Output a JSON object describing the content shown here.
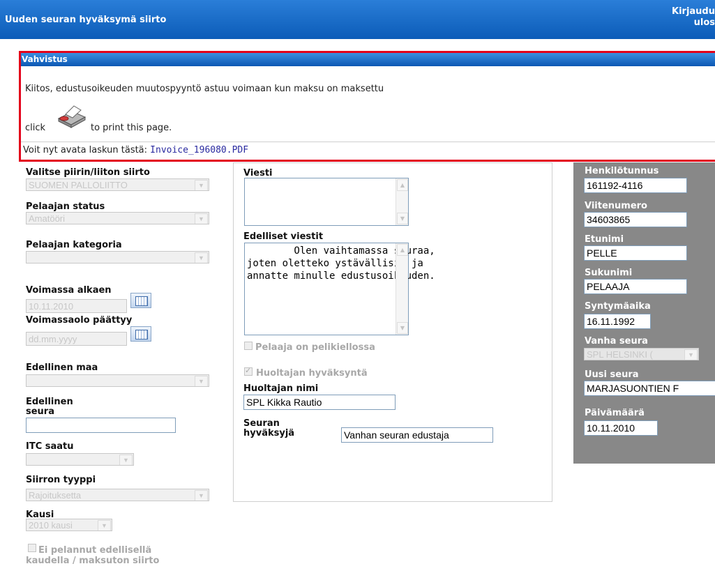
{
  "header": {
    "title": "Uuden seuran hyväksymä siirto",
    "logout_line1": "Kirjaudu",
    "logout_line2": "ulos"
  },
  "dialog": {
    "title": "Vahvistus",
    "message": "Kiitos, edustusoikeuden muutospyyntö astuu voimaan kun maksu on maksettu",
    "click_label": "click",
    "print_label": "to print this page.",
    "invoice_prefix": "Voit nyt avata laskun tästä: ",
    "invoice_link": "Invoice_196080.PDF"
  },
  "left": {
    "district_label": "Valitse piirin/liiton siirto",
    "district_value": "SUOMEN PALLOLIITTO",
    "status_label": "Pelaajan status",
    "status_value": "Amatööri",
    "category_label": "Pelaajan kategoria",
    "category_value": "",
    "valid_from_label": "Voimassa alkaen",
    "valid_from_value": "10.11.2010",
    "valid_to_label": "Voimassaolo päättyy",
    "valid_to_placeholder": "dd.mm.yyyy",
    "prev_country_label": "Edellinen maa",
    "prev_country_value": "",
    "prev_club_label_1": "Edellinen",
    "prev_club_label_2": "seura",
    "prev_club_value": "",
    "itc_label": "ITC saatu",
    "itc_value": "",
    "transfer_type_label": "Siirron tyyppi",
    "transfer_type_value": "Rajoituksetta",
    "season_label": "Kausi",
    "season_value": "2010 kausi",
    "no_play_label_1": "Ei pelannut edellisellä",
    "no_play_label_2": "kaudella / maksuton siirto"
  },
  "middle": {
    "message_label": "Viesti",
    "message_value": "",
    "prev_messages_label": "Edelliset viestit",
    "prev_messages_value": "        Olen vaihtamassa seuraa,\njoten oletteko ystävällisiä ja\nannatte minulle edustusoikeuden.",
    "banned_label": "Pelaaja on pelikiellossa",
    "guardian_approval_label": "Huoltajan hyväksyntä",
    "guardian_name_label": "Huoltajan nimi",
    "guardian_name_value": "SPL Kikka Rautio",
    "club_approver_label_1": "Seuran",
    "club_approver_label_2": "hyväksyjä",
    "club_approver_value": "Vanhan seuran edustaja"
  },
  "right": {
    "ssn_label": "Henkilötunnus",
    "ssn_value": "161192-4116",
    "ref_label": "Viitenumero",
    "ref_value": "34603865",
    "firstname_label": "Etunimi",
    "firstname_value": "PELLE",
    "lastname_label": "Sukunimi",
    "lastname_value": "PELAAJA",
    "birth_label": "Syntymäaika",
    "birth_value": "16.11.1992",
    "old_club_label": "Vanha seura",
    "old_club_value": "SPL HELSINKI (",
    "new_club_label": "Uusi seura",
    "new_club_value": "MARJASUONTIEN F",
    "date_label": "Päivämäärä",
    "date_value": "10.11.2010"
  }
}
